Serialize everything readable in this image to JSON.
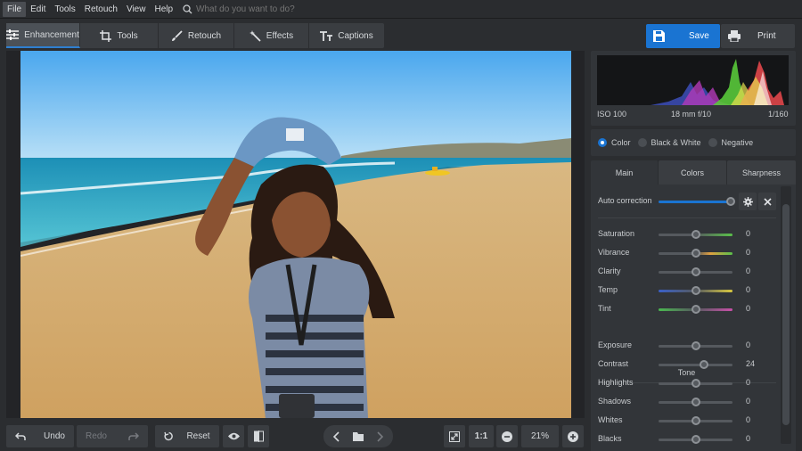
{
  "menubar": {
    "items": [
      "File",
      "Edit",
      "Tools",
      "Retouch",
      "View",
      "Help"
    ],
    "search_placeholder": "What do you want to do?"
  },
  "toolbar": {
    "tabs": [
      "Enhancement",
      "Tools",
      "Retouch",
      "Effects",
      "Captions"
    ],
    "save_label": "Save",
    "print_label": "Print"
  },
  "bottombar": {
    "undo": "Undo",
    "redo": "Redo",
    "reset": "Reset",
    "ratio": "1:1",
    "zoom": "21%"
  },
  "histogram": {
    "iso": "ISO 100",
    "lens": "18 mm f/10",
    "shutter": "1/160"
  },
  "modes": {
    "color": "Color",
    "bw": "Black & White",
    "negative": "Negative"
  },
  "panel_tabs": [
    "Main",
    "Colors",
    "Sharpness"
  ],
  "auto_correction": "Auto correction",
  "sliders": [
    {
      "label": "Saturation",
      "value": "0",
      "knob": 0.5
    },
    {
      "label": "Vibrance",
      "value": "0",
      "knob": 0.5
    },
    {
      "label": "Clarity",
      "value": "0",
      "knob": 0.5
    },
    {
      "label": "Temp",
      "value": "0",
      "knob": 0.5
    },
    {
      "label": "Tint",
      "value": "0",
      "knob": 0.5
    }
  ],
  "tone_title": "Tone",
  "tone_sliders": [
    {
      "label": "Exposure",
      "value": "0",
      "knob": 0.5
    },
    {
      "label": "Contrast",
      "value": "24",
      "knob": 0.62
    },
    {
      "label": "Highlights",
      "value": "0",
      "knob": 0.5
    },
    {
      "label": "Shadows",
      "value": "0",
      "knob": 0.5
    },
    {
      "label": "Whites",
      "value": "0",
      "knob": 0.5
    },
    {
      "label": "Blacks",
      "value": "0",
      "knob": 0.5
    }
  ],
  "colors": {
    "accent": "#1a74d2",
    "panel": "#323539"
  }
}
